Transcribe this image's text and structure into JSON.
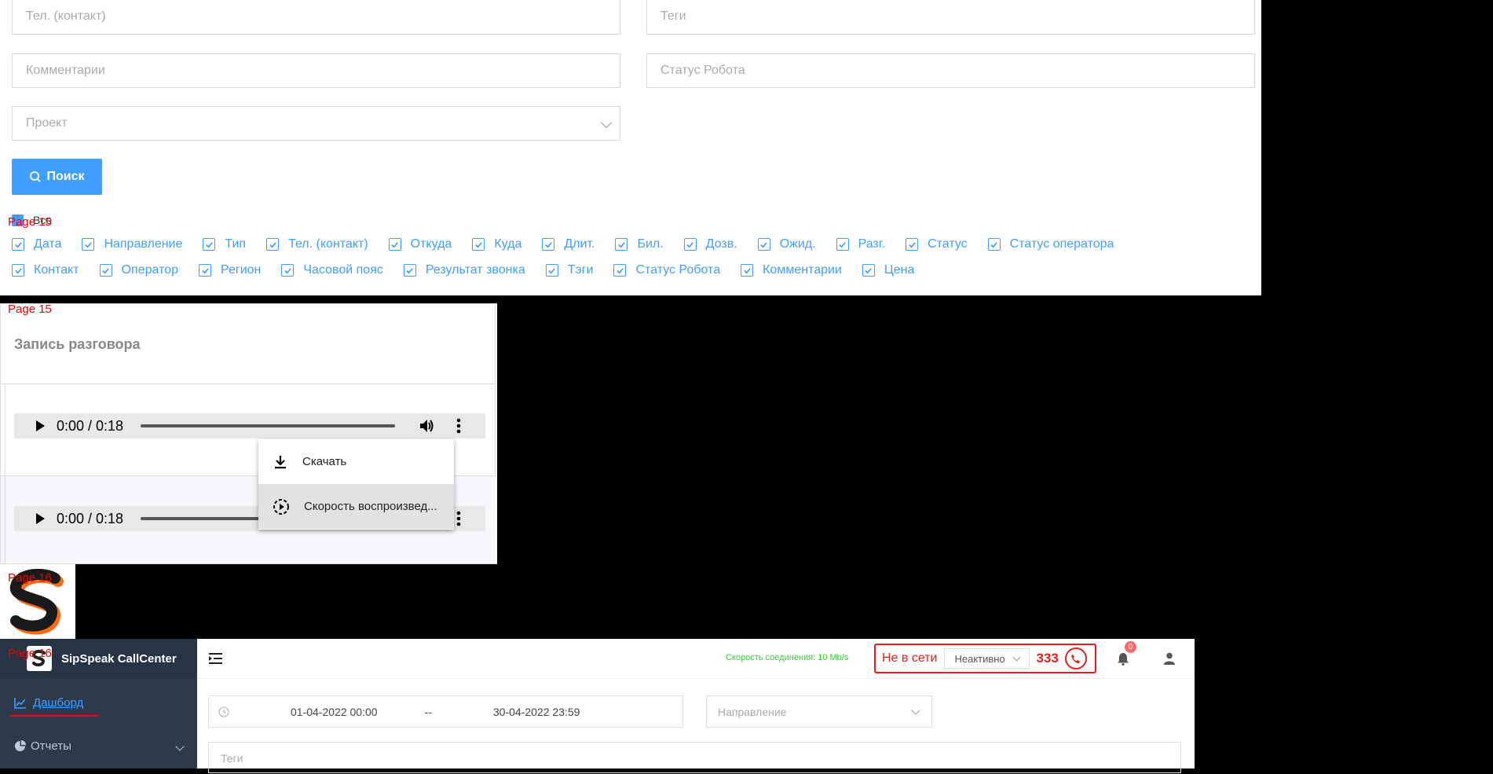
{
  "page_labels": [
    "Page 15",
    "Page 15",
    "Page 16",
    "Page 16"
  ],
  "filters": {
    "phone_placeholder": "Тел. (контакт)",
    "tags_placeholder": "Теги",
    "comments_placeholder": "Комментарии",
    "robot_status_placeholder": "Статус Робота",
    "project_placeholder": "Проект",
    "search_label": "Поиск",
    "all_label": "Все"
  },
  "columns_row1": [
    "Дата",
    "Направление",
    "Тип",
    "Тел. (контакт)",
    "Откуда",
    "Куда",
    "Длит.",
    "Бил.",
    "Дозв.",
    "Ожид.",
    "Разг.",
    "Статус",
    "Статус оператора"
  ],
  "columns_row2": [
    "Контакт",
    "Оператор",
    "Регион",
    "Часовой пояс",
    "Результат звонка",
    "Тэги",
    "Статус Робота",
    "Комментарии",
    "Цена"
  ],
  "recording": {
    "title": "Запись разговора",
    "players": [
      {
        "time": "0:00 / 0:18",
        "progress": 0
      },
      {
        "time": "0:00 / 0:18",
        "progress": 0
      }
    ],
    "menu": {
      "download": "Скачать",
      "speed": "Скорость воспроизвед..."
    }
  },
  "app": {
    "name": "SipSpeak CallCenter",
    "connection_speed": "Скорость соединения: 10 Mb/s",
    "status": "Не в сети",
    "activity": "Неактивно",
    "extension": "333",
    "notifications": "0",
    "sidebar": {
      "dashboard": "Дашборд",
      "reports": "Отчеты"
    },
    "date_from": "01-04-2022 00:00",
    "date_sep": "--",
    "date_to": "30-04-2022 23:59",
    "direction_placeholder": "Направление",
    "tags_placeholder": "Теги"
  },
  "colors": {
    "accent": "#409eff",
    "offline": "#e02020",
    "speed_text": "#33cc33",
    "sidebar_bg": "#2d3a4b"
  }
}
